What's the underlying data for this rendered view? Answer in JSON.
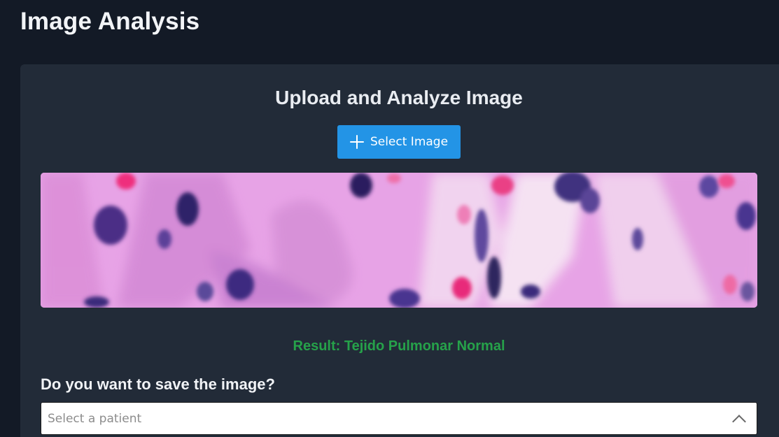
{
  "page": {
    "title": "Image Analysis"
  },
  "upload": {
    "heading": "Upload and Analyze Image",
    "select_button_label": "Select Image",
    "select_button_icon": "plus-icon"
  },
  "analysis": {
    "result_text": "Result: Tejido Pulmonar Normal",
    "result_color": "#26a24a"
  },
  "save": {
    "question": "Do you want to save the image?",
    "patient_select_placeholder": "Select a patient",
    "patient_select_icon": "chevron-up-icon"
  },
  "colors": {
    "background": "#131a26",
    "card": "#222b38",
    "accent": "#2394e6"
  }
}
